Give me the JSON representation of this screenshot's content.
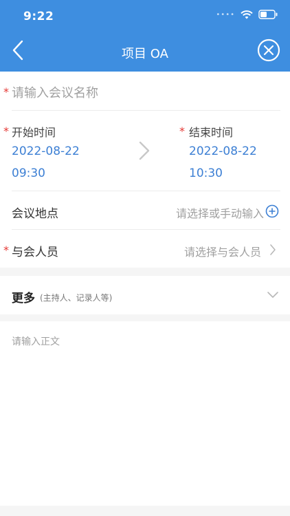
{
  "status_bar": {
    "time": "9:22"
  },
  "nav": {
    "title": "项目 OA"
  },
  "form": {
    "name_placeholder": "请输入会议名称",
    "start": {
      "label": "开始时间",
      "date": "2022-08-22",
      "time": "09:30"
    },
    "end": {
      "label": "结束时间",
      "date": "2022-08-22",
      "time": "10:30"
    },
    "location": {
      "label": "会议地点",
      "placeholder": "请选择或手动输入"
    },
    "attendees": {
      "label": "与会人员",
      "placeholder": "请选择与会人员"
    },
    "required_mark": "*"
  },
  "more": {
    "label": "更多",
    "hint": "(主持人、记录人等)"
  },
  "body": {
    "placeholder": "请输入正文"
  },
  "colors": {
    "header": "#3e8ee0",
    "accent_text": "#3c7fd4",
    "required": "#e53935"
  }
}
